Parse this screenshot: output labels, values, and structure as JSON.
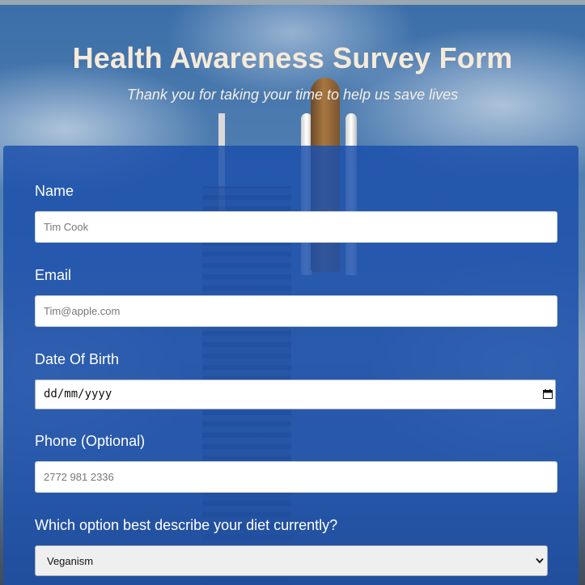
{
  "header": {
    "title": "Health Awareness Survey Form",
    "subtitle": "Thank you for taking your time to help us save lives"
  },
  "form": {
    "name": {
      "label": "Name",
      "placeholder": "Tim Cook",
      "value": ""
    },
    "email": {
      "label": "Email",
      "placeholder": "Tim@apple.com",
      "value": ""
    },
    "dob": {
      "label": "Date Of Birth",
      "display": "dd/mm/yyyy",
      "icon": "calendar-icon"
    },
    "phone": {
      "label": "Phone (Optional)",
      "placeholder": "2772 981 2336",
      "value": ""
    },
    "diet": {
      "label": "Which option best describe your diet currently?",
      "selected": "Veganism",
      "icon": "chevron-down-icon"
    }
  },
  "colors": {
    "title": "#f6ead9",
    "panel": "#1b50ab",
    "label": "#ffffff"
  }
}
